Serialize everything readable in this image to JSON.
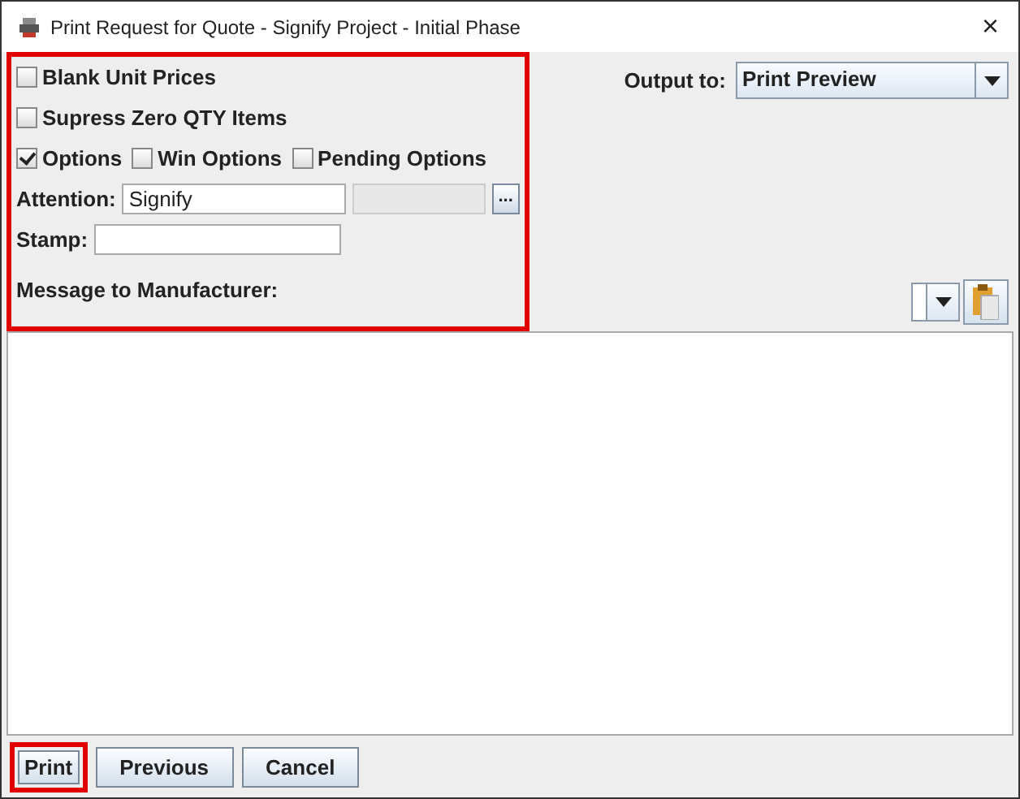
{
  "window": {
    "title": "Print Request for Quote - Signify Project - Initial Phase",
    "close": "×"
  },
  "options": [
    {
      "label": "Blank Unit Prices",
      "checked": false
    },
    {
      "label": "Supress Zero QTY Items",
      "checked": false
    }
  ],
  "option_row": [
    {
      "label": "Options",
      "checked": true
    },
    {
      "label": "Win Options",
      "checked": false
    },
    {
      "label": "Pending Options",
      "checked": false
    }
  ],
  "attention": {
    "label": "Attention:",
    "value": "Signify",
    "browse": "..."
  },
  "stamp": {
    "label": "Stamp:"
  },
  "message_label": "Message to Manufacturer:",
  "output": {
    "label": "Output to:",
    "value": "Print Preview"
  },
  "buttons": [
    {
      "label": "Print",
      "highlighted": true
    },
    {
      "label": "Previous",
      "highlighted": false
    },
    {
      "label": "Cancel",
      "highlighted": false
    }
  ]
}
